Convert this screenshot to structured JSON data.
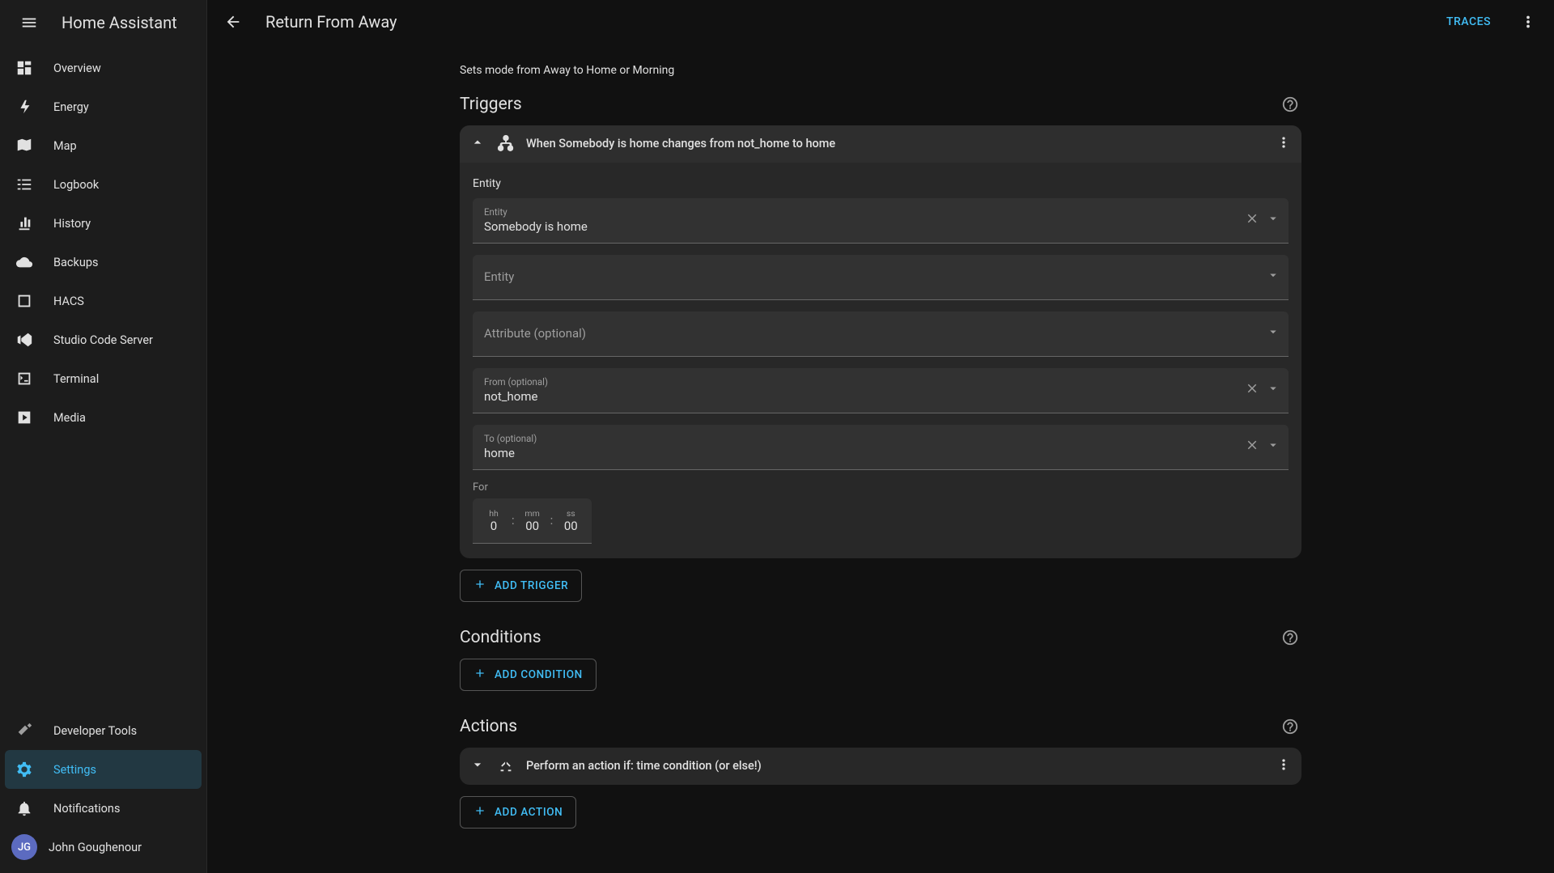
{
  "app_title": "Home Assistant",
  "sidebar": {
    "items": [
      {
        "label": "Overview"
      },
      {
        "label": "Energy"
      },
      {
        "label": "Map"
      },
      {
        "label": "Logbook"
      },
      {
        "label": "History"
      },
      {
        "label": "Backups"
      },
      {
        "label": "HACS"
      },
      {
        "label": "Studio Code Server"
      },
      {
        "label": "Terminal"
      },
      {
        "label": "Media"
      }
    ],
    "dev_tools": "Developer Tools",
    "settings": "Settings",
    "notifications": "Notifications",
    "user_initials": "JG",
    "user_name": "John Goughenour"
  },
  "header": {
    "title": "Return From Away",
    "traces": "TRACES"
  },
  "automation": {
    "description": "Sets mode from Away to Home or Morning",
    "sections": {
      "triggers": "Triggers",
      "conditions": "Conditions",
      "actions": "Actions"
    },
    "trigger": {
      "summary": "When Somebody is home changes from not_home to home",
      "entity_section_label": "Entity",
      "entity_label": "Entity",
      "entity_value": "Somebody is home",
      "entity2_label": "Entity",
      "attribute_label": "Attribute (optional)",
      "from_label": "From (optional)",
      "from_value": "not_home",
      "to_label": "To (optional)",
      "to_value": "home",
      "for_label": "For",
      "for_hh_label": "hh",
      "for_hh": "0",
      "for_mm_label": "mm",
      "for_mm": "00",
      "for_ss_label": "ss",
      "for_ss": "00"
    },
    "buttons": {
      "add_trigger": "ADD TRIGGER",
      "add_condition": "ADD CONDITION",
      "add_action": "ADD ACTION"
    },
    "action": {
      "summary": "Perform an action if: time condition (or else!)"
    }
  }
}
